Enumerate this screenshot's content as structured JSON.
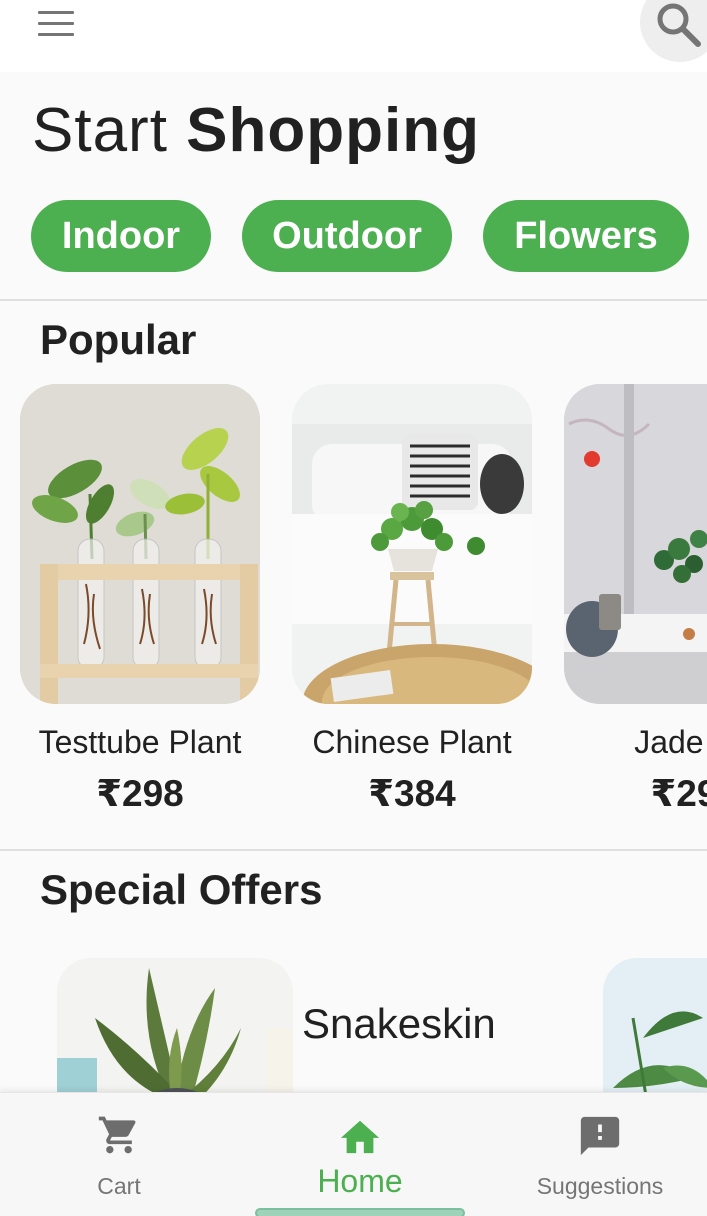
{
  "header": {
    "title_light": "Start",
    "title_bold": "Shopping"
  },
  "categories": [
    {
      "label": "Indoor"
    },
    {
      "label": "Outdoor"
    },
    {
      "label": "Flowers"
    }
  ],
  "popular": {
    "heading": "Popular",
    "items": [
      {
        "name": "Testtube Plant",
        "price": "₹298"
      },
      {
        "name": "Chinese Plant",
        "price": "₹384"
      },
      {
        "name": "Jade P",
        "price": "₹29"
      }
    ]
  },
  "special_offers": {
    "heading": "Special Offers",
    "items": [
      {
        "name": "Snakeskin"
      }
    ]
  },
  "bottom_nav": {
    "items": [
      {
        "label": "Cart",
        "icon": "cart-icon"
      },
      {
        "label": "Home",
        "icon": "home-icon",
        "active": true
      },
      {
        "label": "Suggestions",
        "icon": "feedback-icon"
      }
    ]
  },
  "colors": {
    "accent": "#4caf50",
    "background": "#fafafa",
    "text": "#212121",
    "muted": "#757575"
  }
}
